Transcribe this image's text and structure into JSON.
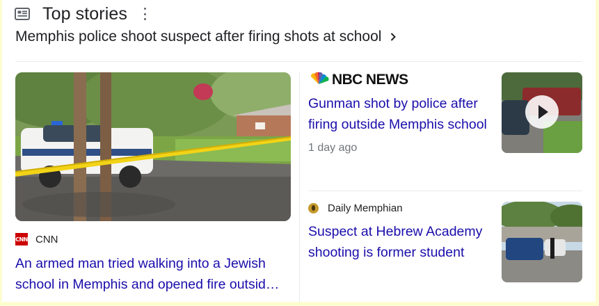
{
  "header": {
    "title": "Top stories",
    "icon": "newspaper-icon",
    "more_icon": "kebab-menu-icon"
  },
  "topic": {
    "text": "Memphis police shoot suspect after firing shots at school",
    "icon": "chevron-right-icon"
  },
  "stories": [
    {
      "source": "CNN",
      "source_logo_text": "CNN",
      "headline": "An armed man tried walking into a Jewish school in Memphis and opened fire outsid…",
      "image": "police-car-crime-scene-photo"
    },
    {
      "source": "NBC NEWS",
      "headline": "Gunman shot by police after firing outside Memphis school",
      "time": "1 day ago",
      "image": "video-thumbnail",
      "has_video": true
    },
    {
      "source": "Daily Memphian",
      "headline": "Suspect at Hebrew Academy shooting is former student",
      "image": "police-scene-thumbnail"
    }
  ],
  "colors": {
    "link": "#1a0dab",
    "text": "#202124",
    "muted": "#70757a",
    "page_bg": "#fdfdd0"
  }
}
